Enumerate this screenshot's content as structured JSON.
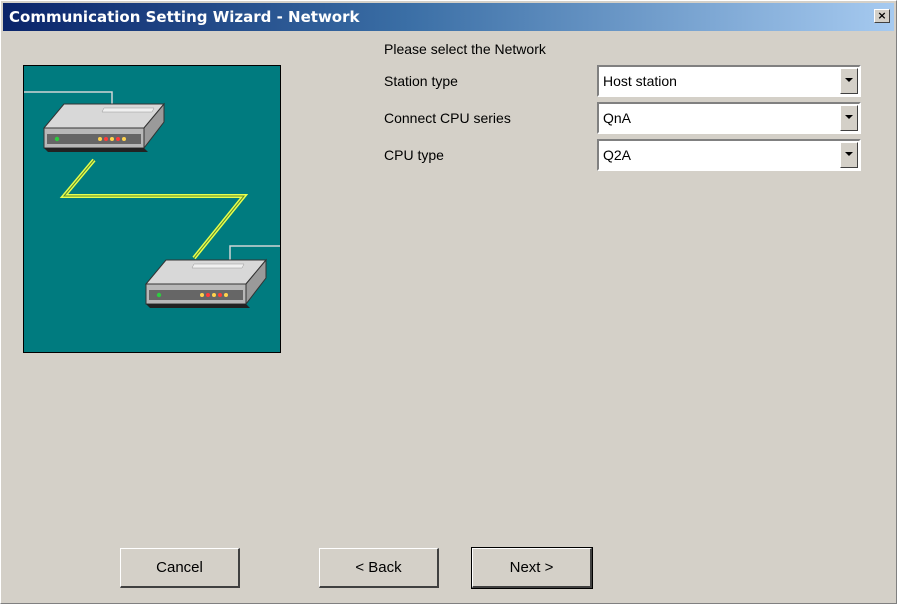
{
  "window": {
    "title": "Communication Setting Wizard - Network",
    "close_glyph": "×"
  },
  "form": {
    "prompt": "Please select the Network",
    "fields": [
      {
        "label": "Station type",
        "value": "Host station"
      },
      {
        "label": "Connect CPU series",
        "value": "QnA"
      },
      {
        "label": "CPU type",
        "value": "Q2A"
      }
    ]
  },
  "buttons": {
    "cancel": "Cancel",
    "back": "< Back",
    "next": "Next >"
  },
  "colors": {
    "title_start": "#0a246a",
    "title_end": "#a6caf0",
    "illustration_bg": "#007b7f",
    "cable": "#e6ff4d"
  },
  "icons": {
    "close": "close-icon",
    "dropdown": "dropdown-arrow-icon",
    "network_device": "network-device-icon"
  }
}
